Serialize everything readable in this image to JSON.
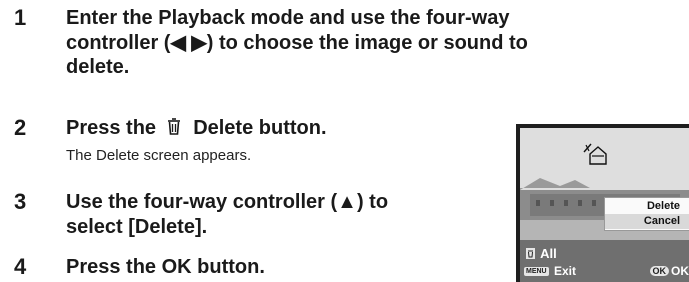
{
  "steps": [
    {
      "number": "1",
      "line1": "Enter the Playback mode and use the four-way",
      "line2": "controller (◀ ▶) to choose the image or sound to",
      "line3": "delete."
    },
    {
      "number": "2",
      "title_prefix": "Press the",
      "title_suffix": "Delete button.",
      "description": "The Delete screen appears."
    },
    {
      "number": "3",
      "line1": "Use the four-way controller (▲) to",
      "line2": "select [Delete]."
    },
    {
      "number": "4",
      "line1": "Press the OK button."
    }
  ],
  "lcd": {
    "menu_delete": "Delete",
    "menu_cancel": "Cancel",
    "all_label": "All",
    "menu_chip": "MENU",
    "exit_label": "Exit",
    "ok_chip": "OK",
    "ok_label": "OK"
  },
  "icons": {
    "delete_button": "trash-icon",
    "protect": "protect-icon"
  }
}
